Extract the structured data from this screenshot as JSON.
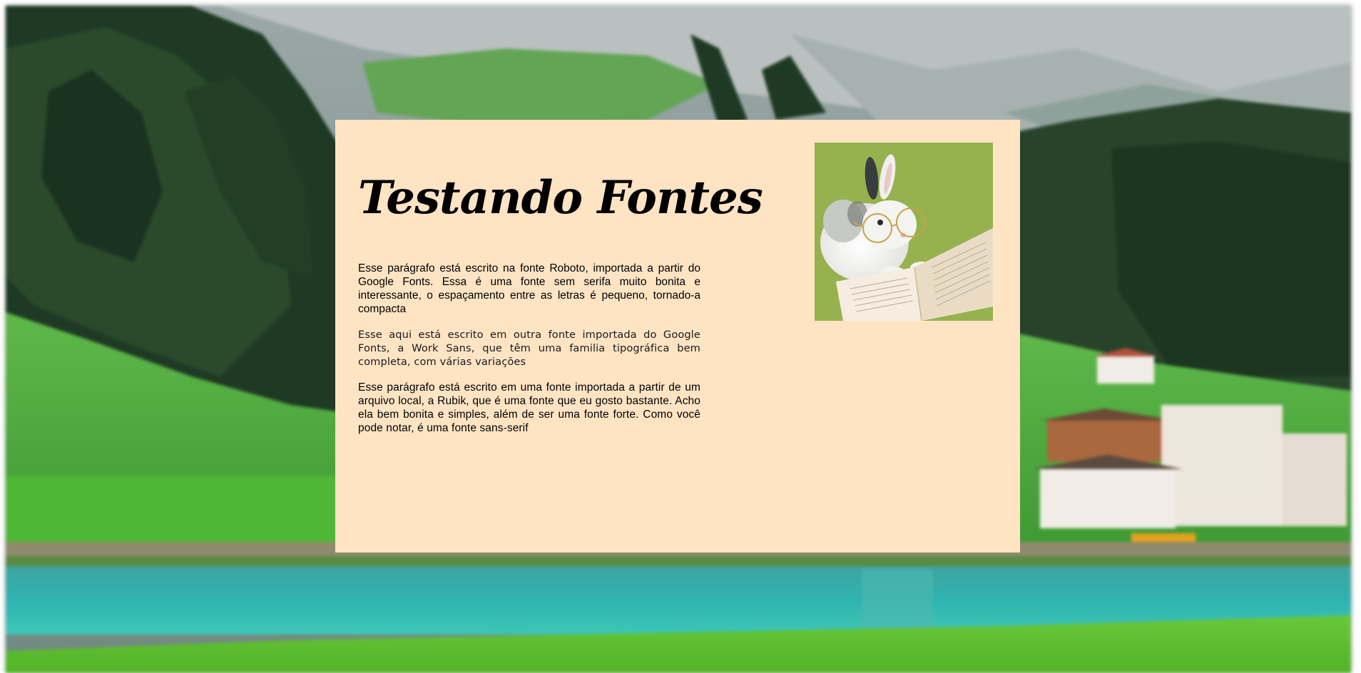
{
  "page": {
    "title": "Testando Fontes",
    "paragraphs": [
      "Esse parágrafo está escrito na fonte Roboto, importada a partir do Google Fonts. Essa é uma fonte sem serifa muito bonita e interessante, o espaçamento entre as letras é pequeno, tornado-a compacta",
      "Esse aqui está escrito em outra fonte importada do Google Fonts, a Work Sans, que têm uma familia tipográfica bem completa, com várias variações",
      "Esse parágrafo está escrito em uma fonte importada a partir de um arquivo local, a Rubik, que é uma fonte que eu gosto bastante. Acho ela bem bonita e simples, além de ser uma fonte forte. Como você pode notar, é uma fonte sans-serif"
    ]
  },
  "colors": {
    "card_background": "#ffe4c4",
    "text": "#000000"
  },
  "images": {
    "background": "mountain-valley-lake-photo",
    "card_image": "rabbit-with-glasses-reading-book-photo"
  }
}
